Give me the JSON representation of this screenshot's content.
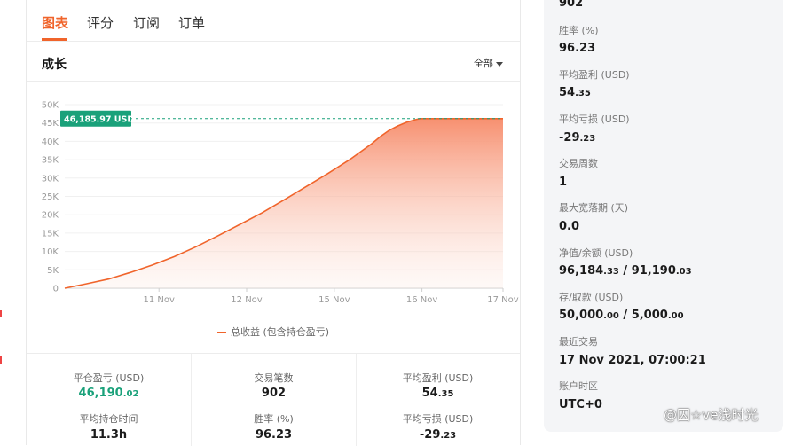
{
  "tabs": [
    "图表",
    "评分",
    "订阅",
    "订单"
  ],
  "growth": {
    "title": "成长",
    "filter": "全部"
  },
  "tooltip": "46,185.97 USD",
  "chart_data": {
    "type": "area",
    "x_ticks": [
      "11 Nov",
      "12 Nov",
      "15 Nov",
      "16 Nov",
      "17 Nov"
    ],
    "y_ticks": [
      "0",
      "5K",
      "10K",
      "15K",
      "20K",
      "25K",
      "30K",
      "35K",
      "40K",
      "45K",
      "50K"
    ],
    "ylim": [
      0,
      50000
    ],
    "series": [
      {
        "name": "总收益 (包含持仓盈亏)",
        "x": [
          0,
          0.05,
          0.1,
          0.15,
          0.2,
          0.25,
          0.3,
          0.35,
          0.4,
          0.45,
          0.5,
          0.55,
          0.6,
          0.65,
          0.7,
          0.72,
          0.74,
          0.76,
          0.78,
          0.8,
          0.81,
          0.82,
          1.0
        ],
        "values": [
          0,
          1200,
          2500,
          4300,
          6300,
          8600,
          11300,
          14300,
          17400,
          20500,
          24000,
          27600,
          31200,
          35000,
          39300,
          41300,
          43000,
          44200,
          45200,
          45900,
          46186,
          46186,
          46186
        ]
      }
    ],
    "guide_value": 46185.97,
    "legend": "总收益 (包含持仓盈亏)",
    "colors": {
      "line": "#f0642b",
      "fill_top": "#f79070",
      "guide": "#1aa17a"
    }
  },
  "stats": [
    {
      "label": "平仓盈亏 (USD)",
      "main": "46,190",
      "dec": ".02",
      "label2": "平均持仓时间",
      "value2": "11.3h"
    },
    {
      "label": "交易笔数",
      "main": "902",
      "dec": "",
      "label2": "胜率 (%)",
      "value2": "96.23"
    },
    {
      "label": "平均盈利 (USD)",
      "main": "54",
      "dec": ".35",
      "label2": "平均亏损 (USD)",
      "value2_main": "-29",
      "value2_dec": ".23"
    }
  ],
  "right": {
    "top_value": "902",
    "items": [
      {
        "label": "胜率 (%)",
        "value": "96.23"
      },
      {
        "label": "平均盈利 (USD)",
        "value_main": "54",
        "value_dec": ".35"
      },
      {
        "label": "平均亏损 (USD)",
        "value_main": "-29",
        "value_dec": ".23"
      },
      {
        "label": "交易周数",
        "value": "1"
      },
      {
        "label": "最大宽落期 (天)",
        "value": "0.0"
      },
      {
        "label": "净值/余额 (USD)",
        "a_main": "96,184",
        "a_dec": ".33",
        "sep": " / ",
        "b_main": "91,190",
        "b_dec": ".03"
      },
      {
        "label": "存/取款 (USD)",
        "a_main": "50,000",
        "a_dec": ".00",
        "sep": " / ",
        "b_main": "5,000",
        "b_dec": ".00"
      },
      {
        "label": "最近交易",
        "value": "17 Nov 2021, 07:00:21"
      },
      {
        "label": "账户时区",
        "value": "UTC+0"
      }
    ]
  },
  "watermark": "@囚☆ve浅时光"
}
